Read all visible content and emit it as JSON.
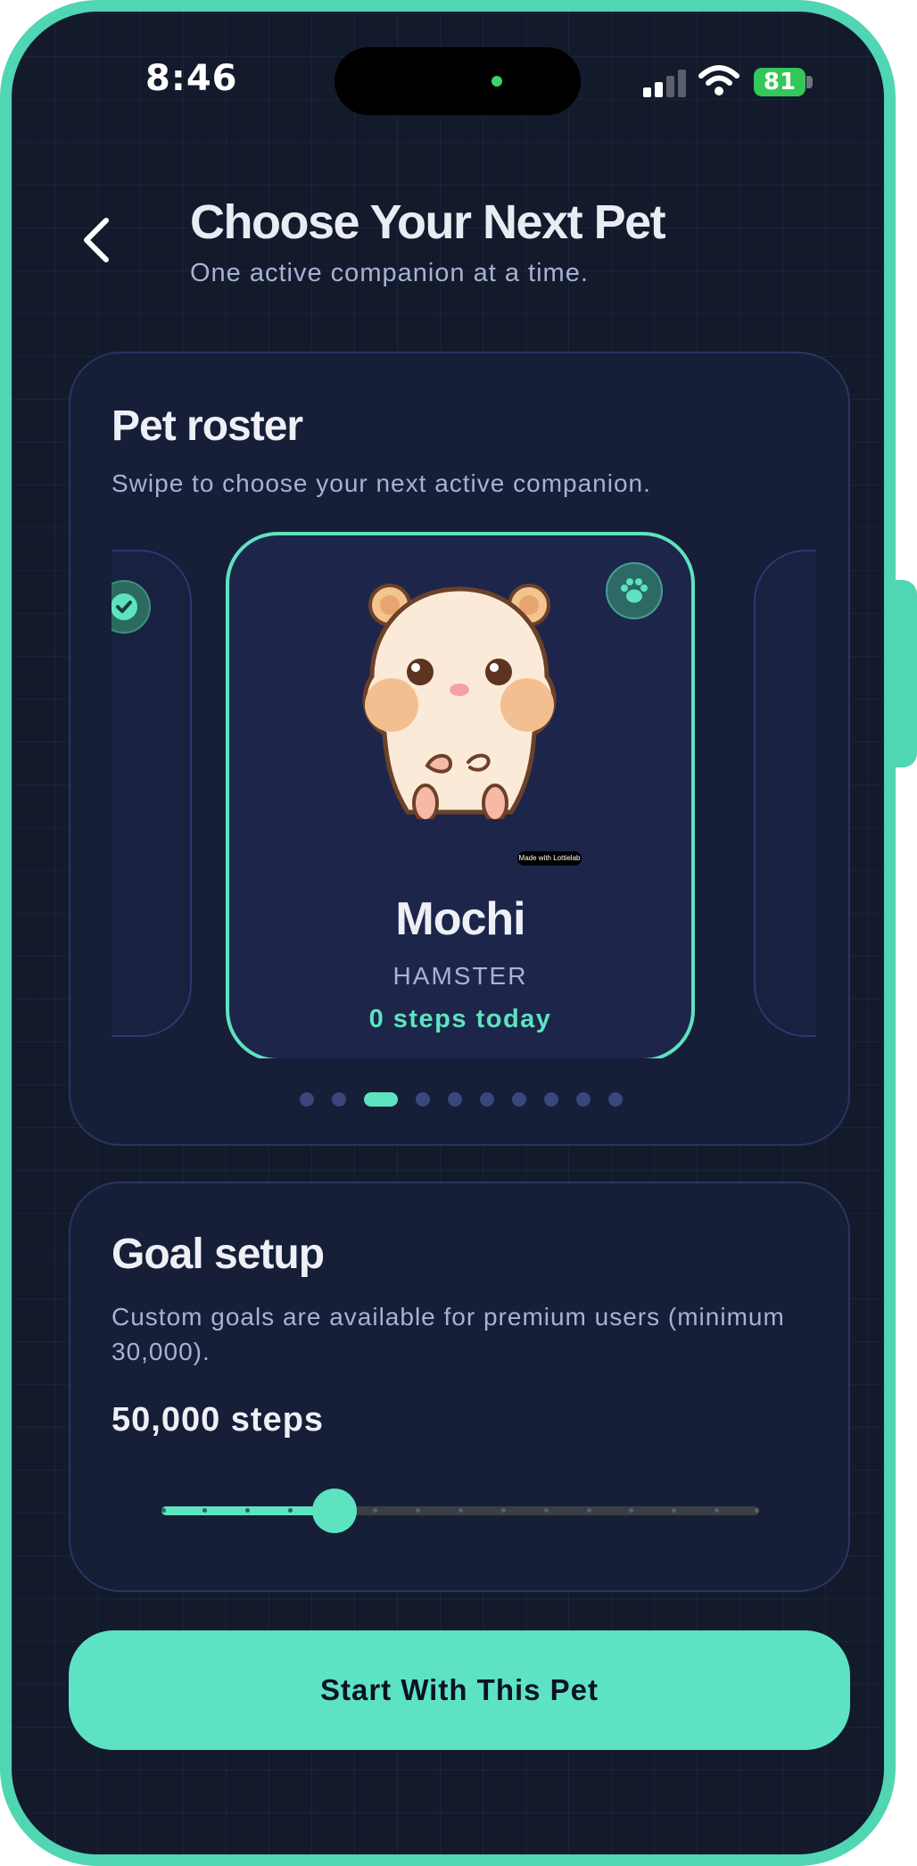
{
  "status_bar": {
    "time": "8:46",
    "battery_percent": "81"
  },
  "header": {
    "title": "Choose Your Next Pet",
    "subtitle": "One active companion at a time."
  },
  "roster": {
    "title": "Pet roster",
    "description": "Swipe to choose your next active companion.",
    "selected_pet": {
      "name": "Mochi",
      "species": "HAMSTER",
      "steps": "0 steps today",
      "watermark": "Made with Lottielab"
    },
    "page_count": 10,
    "active_page": 3
  },
  "goal": {
    "title": "Goal setup",
    "description": "Custom goals are available for premium users (minimum 30,000).",
    "value_label": "50,000 steps",
    "slider_position": 0.29,
    "slider_steps": 15
  },
  "cta": {
    "label": "Start With This Pet"
  },
  "colors": {
    "accent": "#5de3bf",
    "frame": "#50d6b2",
    "background": "#121a2c",
    "card": "#161e38"
  }
}
